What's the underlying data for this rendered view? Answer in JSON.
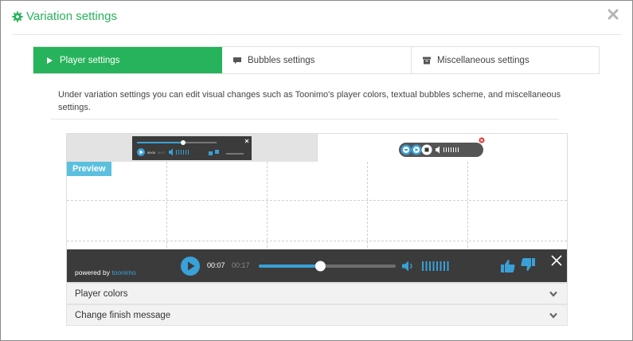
{
  "dialog": {
    "title": "Variation settings",
    "close_icon": "close-icon",
    "gear_icon": "gear-icon"
  },
  "tabs": [
    {
      "label": "Player settings",
      "icon": "play-icon",
      "active": true
    },
    {
      "label": "Bubbles settings",
      "icon": "speech-bubble-icon",
      "active": false
    },
    {
      "label": "Miscellaneous settings",
      "icon": "archive-icon",
      "active": false
    }
  ],
  "description": "Under variation settings you can edit visual changes such as Toonimo's player colors, textual bubbles scheme, and miscellaneous settings.",
  "preview": {
    "label": "Preview",
    "variant_thumbnails": [
      {
        "name": "full-player-variant",
        "times": [
          "00:00",
          "00:17"
        ]
      },
      {
        "name": "compact-player-variant"
      }
    ]
  },
  "player": {
    "powered_prefix": "powered by ",
    "brand": "toonimo",
    "current_time": "00:07",
    "total_time": "00:17",
    "progress": 0.45,
    "volume_icon": "volume-icon",
    "like_icon": "thumbs-up-icon",
    "dislike_icon": "thumbs-down-icon",
    "close_icon": "close-icon"
  },
  "accordion": [
    {
      "label": "Player colors"
    },
    {
      "label": "Change finish message"
    }
  ],
  "colors": {
    "accent": "#27b35b",
    "player_bg": "#3b3b3b",
    "player_blue": "#3aa0d8",
    "preview_label": "#5bc0de"
  }
}
